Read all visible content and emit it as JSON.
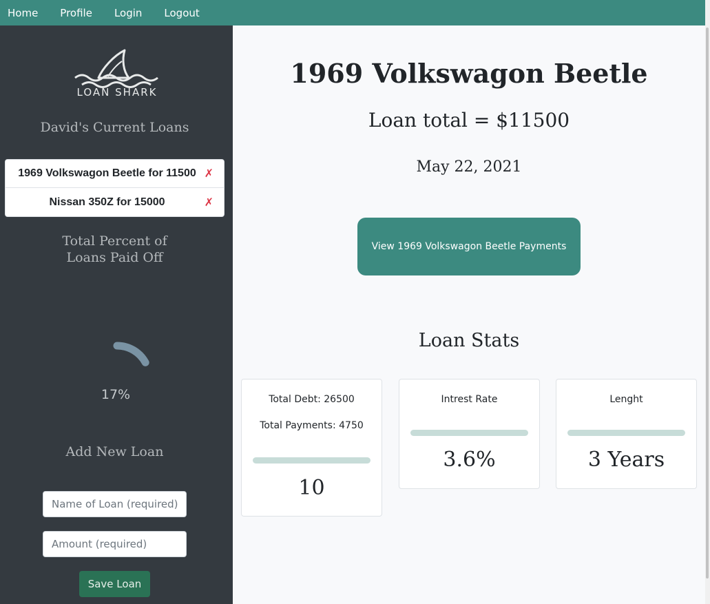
{
  "nav": [
    "Home",
    "Profile",
    "Login",
    "Logout"
  ],
  "sidebar": {
    "logo_text": "LOAN SHARK",
    "loans_heading": "David's Current Loans",
    "loans": [
      {
        "label": "1969 Volkswagon Beetle for 11500",
        "delete": "✗"
      },
      {
        "label": "Nissan 350Z for 15000",
        "delete": "✗"
      }
    ],
    "paid_heading": "Total Percent of Loans Paid Off",
    "paid_percent": "17%",
    "paid_fraction": 0.17,
    "add_heading": "Add New Loan",
    "name_placeholder": "Name of Loan (required)",
    "amount_placeholder": "Amount (required)",
    "save_label": "Save Loan"
  },
  "main": {
    "title": "1969 Volkswagon Beetle",
    "loan_total": "Loan total = $11500",
    "date": "May 22, 2021",
    "view_button": "View 1969 Volkswagon Beetle Payments",
    "stats_heading": "Loan Stats",
    "cards": {
      "debt": {
        "total_debt": "Total Debt: 26500",
        "total_payments": "Total Payments: 4750",
        "value": "10"
      },
      "rate": {
        "label": "Intrest Rate",
        "value": "3.6%"
      },
      "length": {
        "label": "Lenght",
        "value": "3 Years"
      }
    }
  },
  "colors": {
    "accent": "#3c8a80",
    "sidebar": "#343a40",
    "danger": "#dc3545",
    "save": "#2a7255"
  }
}
